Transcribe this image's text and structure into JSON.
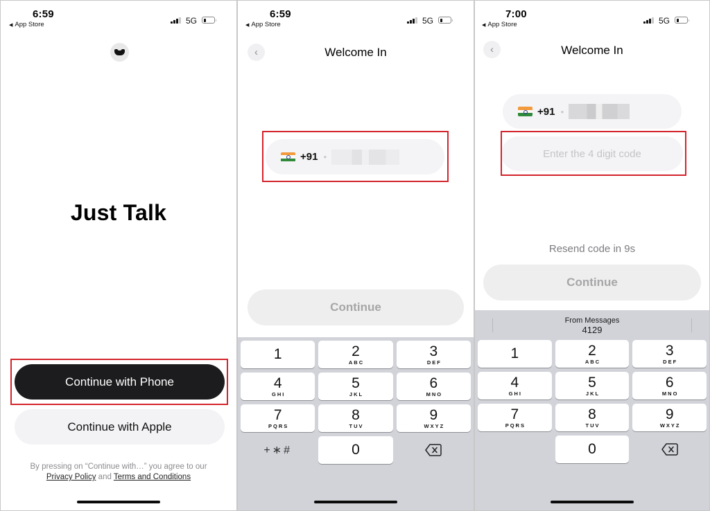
{
  "screens": [
    {
      "status": {
        "time": "6:59",
        "back_app": "App Store",
        "network": "5G"
      },
      "logo_icon": "app-logo-icon",
      "hero_title": "Just Talk",
      "buttons": {
        "phone": "Continue with Phone",
        "apple": "Continue with Apple"
      },
      "legal": {
        "prefix": "By pressing on “Continue with…” you agree to our",
        "privacy": "Privacy Policy",
        "and": "and",
        "terms": "Terms and Conditions"
      }
    },
    {
      "status": {
        "time": "6:59",
        "back_app": "App Store",
        "network": "5G"
      },
      "nav": {
        "back_icon": "‹",
        "title": "Welcome In"
      },
      "phone_field": {
        "country_flag": "india-flag-icon",
        "country_code": "+91",
        "number_value": "(redacted)"
      },
      "continue_label": "Continue",
      "keypad": {
        "keys": [
          {
            "digit": "1",
            "letters": ""
          },
          {
            "digit": "2",
            "letters": "ABC"
          },
          {
            "digit": "3",
            "letters": "DEF"
          },
          {
            "digit": "4",
            "letters": "GHI"
          },
          {
            "digit": "5",
            "letters": "JKL"
          },
          {
            "digit": "6",
            "letters": "MNO"
          },
          {
            "digit": "7",
            "letters": "PQRS"
          },
          {
            "digit": "8",
            "letters": "TUV"
          },
          {
            "digit": "9",
            "letters": "WXYZ"
          },
          {
            "digit": "0",
            "letters": ""
          }
        ],
        "symbols_label": "+∗#"
      }
    },
    {
      "status": {
        "time": "7:00",
        "back_app": "App Store",
        "network": "5G"
      },
      "nav": {
        "back_icon": "‹",
        "title": "Welcome In"
      },
      "phone_field": {
        "country_flag": "india-flag-icon",
        "country_code": "+91",
        "number_value": "(redacted)"
      },
      "code_field": {
        "placeholder": "Enter the 4 digit code",
        "value": ""
      },
      "resend_text": "Resend code in 9s",
      "continue_label": "Continue",
      "suggestion": {
        "source": "From Messages",
        "code": "4129"
      }
    }
  ],
  "colors": {
    "highlight": "#d3232a",
    "primary_button": "#1c1c1e",
    "keyboard_bg": "#d1d3d9"
  }
}
